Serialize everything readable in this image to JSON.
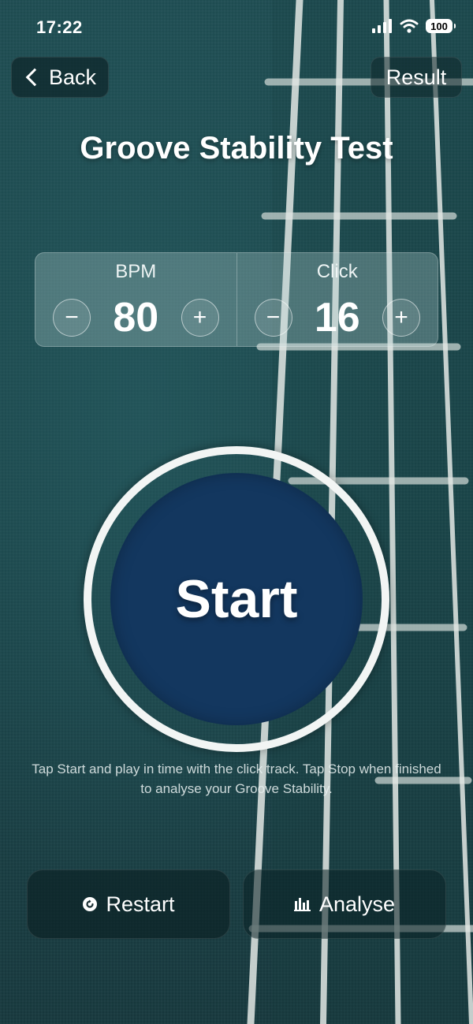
{
  "status_bar": {
    "time": "17:22",
    "battery": "100"
  },
  "nav": {
    "back_label": "Back",
    "result_label": "Result"
  },
  "title": "Groove Stability Test",
  "bpm": {
    "label": "BPM",
    "value": "80",
    "minus": "−",
    "plus": "+"
  },
  "click": {
    "label": "Click",
    "value": "16",
    "minus": "−",
    "plus": "+"
  },
  "start_label": "Start",
  "instructions": "Tap Start and play in time with the click track. Tap Stop when finished to analyse your Groove Stability.",
  "actions": {
    "restart_label": "Restart",
    "analyse_label": "Analyse"
  },
  "colors": {
    "background": "#1d4a4f",
    "start_button": "#13375f",
    "ring": "#f2f5f4"
  }
}
